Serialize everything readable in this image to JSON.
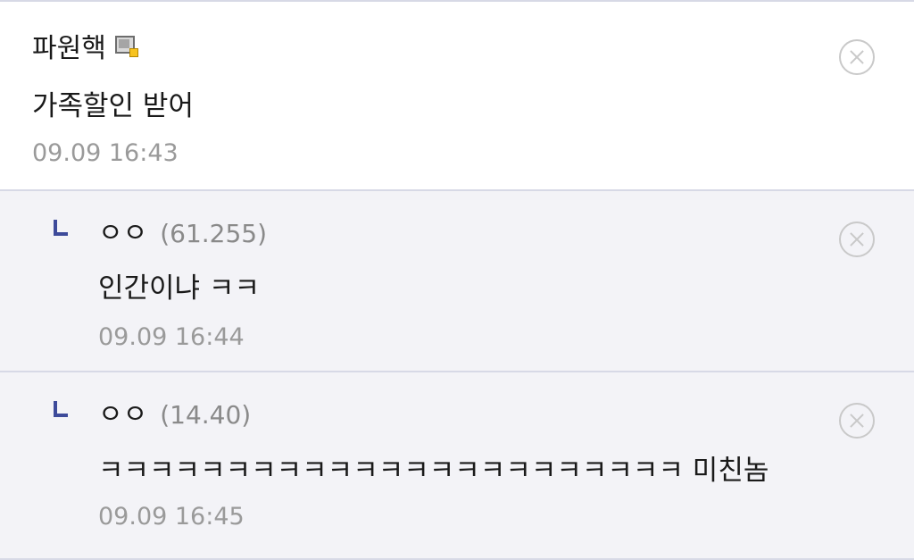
{
  "comments": [
    {
      "nickname": "파원핵",
      "content": "가족할인 받어",
      "time": "09.09 16:43",
      "badge_icon": "member-badge-icon"
    }
  ],
  "replies": [
    {
      "nickname": "ㅇㅇ",
      "ip": "(61.255)",
      "content": "인간이냐 ㅋㅋ",
      "time": "09.09 16:44"
    },
    {
      "nickname": "ㅇㅇ",
      "ip": "(14.40)",
      "content": "ㅋㅋㅋㅋㅋㅋㅋㅋㅋㅋㅋㅋㅋㅋㅋㅋㅋㅋㅋㅋㅋㅋㅋ 미친놈",
      "time": "09.09 16:45"
    }
  ],
  "colors": {
    "reply_bg": "#f3f3f7",
    "divider": "#d7d9e6",
    "reply_marker": "#3d4a9a",
    "meta_text": "#9a9a9a"
  }
}
